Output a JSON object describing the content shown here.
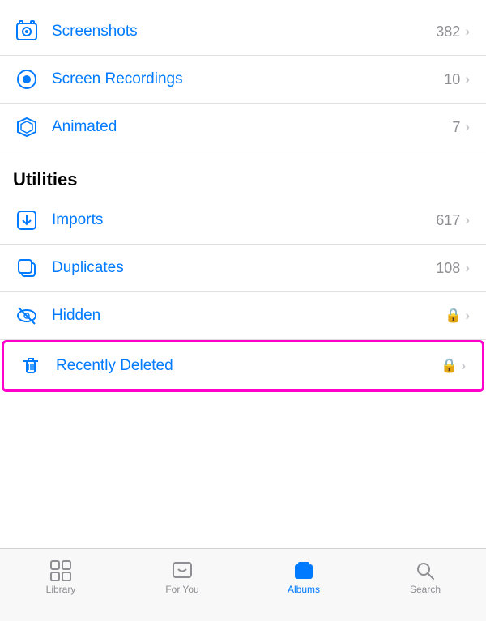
{
  "sections": [
    {
      "items": [
        {
          "id": "screenshots",
          "label": "Screenshots",
          "count": "382",
          "hasLock": false
        },
        {
          "id": "screen-recordings",
          "label": "Screen Recordings",
          "count": "10",
          "hasLock": false
        },
        {
          "id": "animated",
          "label": "Animated",
          "count": "7",
          "hasLock": false
        }
      ]
    },
    {
      "header": "Utilities",
      "items": [
        {
          "id": "imports",
          "label": "Imports",
          "count": "617",
          "hasLock": false
        },
        {
          "id": "duplicates",
          "label": "Duplicates",
          "count": "108",
          "hasLock": false
        },
        {
          "id": "hidden",
          "label": "Hidden",
          "count": "",
          "hasLock": true
        },
        {
          "id": "recently-deleted",
          "label": "Recently Deleted",
          "count": "",
          "hasLock": true,
          "highlighted": true
        }
      ]
    }
  ],
  "tabs": [
    {
      "id": "library",
      "label": "Library",
      "active": false
    },
    {
      "id": "for-you",
      "label": "For You",
      "active": false
    },
    {
      "id": "albums",
      "label": "Albums",
      "active": true
    },
    {
      "id": "search",
      "label": "Search",
      "active": false
    }
  ]
}
